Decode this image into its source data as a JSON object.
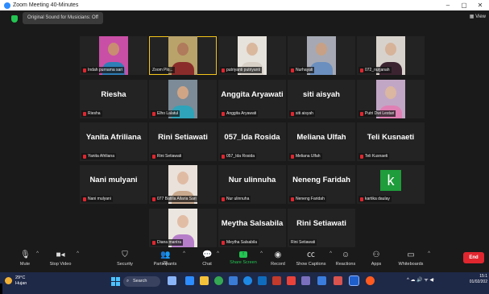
{
  "window": {
    "title": "Zoom Meeting 40-Minutes",
    "controls": [
      "–",
      "▢",
      "✕"
    ]
  },
  "infobar": {
    "sound_pill": "Original Sound for Musicians: Off",
    "view_label": "▦ View"
  },
  "tiles": [
    {
      "label": "Indah purnama sari",
      "video": true,
      "skin": "#c98d72",
      "cloth": "#2e7fb8",
      "bg": "#c94fa6",
      "active": false,
      "muted": true
    },
    {
      "label": "Zoom Plo...",
      "video": true,
      "skin": "#b07a5c",
      "cloth": "#8a2d2a",
      "bg": "#b9a36a",
      "active": true,
      "muted": false
    },
    {
      "label": "putriyanti putriyanti",
      "video": true,
      "skin": "#d9b89e",
      "cloth": "#d7d0c7",
      "bg": "#e6e2dc",
      "active": false,
      "muted": true
    },
    {
      "label": "Nurhayati",
      "video": true,
      "skin": "#c7a085",
      "cloth": "#6b8fbf",
      "bg": "#a6a9b3",
      "active": false,
      "muted": true
    },
    {
      "label": "072_nurjanah",
      "video": true,
      "skin": "#d6b399",
      "cloth": "#3b2430",
      "bg": "#d8d2cd",
      "active": false,
      "muted": true
    },
    {
      "label": "Riesha",
      "name": "Riesha",
      "video": false,
      "muted": true
    },
    {
      "label": "Elho Lalatul",
      "video": true,
      "skin": "#d0a586",
      "cloth": "#2fa3b9",
      "bg": "#7c8b97",
      "active": false,
      "muted": true
    },
    {
      "label": "Anggita Aryawati",
      "name": "Anggita Aryawati",
      "video": false,
      "muted": true
    },
    {
      "label": "siti aisyah",
      "name": "siti aisyah",
      "video": false,
      "muted": true
    },
    {
      "label": "Putri Dwi Lestari",
      "video": true,
      "skin": "#dbb6a0",
      "cloth": "#e07fb3",
      "bg": "#c2a6c5",
      "active": false,
      "muted": true
    },
    {
      "label": "Yanita Afriliana",
      "name": "Yanita Afriliana",
      "video": false,
      "muted": true
    },
    {
      "label": "Rini Setiawati",
      "name": "Rini Setiawati",
      "video": false,
      "muted": true
    },
    {
      "label": "057_Ida Rosida",
      "name": "057_Ida Rosida",
      "video": false,
      "muted": true
    },
    {
      "label": "Meliana Ulfah",
      "name": "Meliana Ulfah",
      "video": false,
      "muted": true
    },
    {
      "label": "Teli Kusnaeti",
      "name": "Teli Kusnaeti",
      "video": false,
      "muted": true
    },
    {
      "label": "Nani mulyani",
      "name": "Nani mulyani",
      "video": false,
      "muted": true
    },
    {
      "label": "077 Batilla Allaria Sari",
      "video": true,
      "skin": "#e0bba3",
      "cloth": "#c9a98d",
      "bg": "#e9e1da",
      "active": false,
      "muted": true
    },
    {
      "label": "Nur ulinnuha",
      "name": "Nur ulinnuha",
      "video": false,
      "muted": true
    },
    {
      "label": "Neneng Faridah",
      "name": "Neneng Faridah",
      "video": false,
      "muted": true
    },
    {
      "label": "kartika daulay",
      "avatar_letter": "k",
      "video": false,
      "muted": true
    },
    {
      "label": "Diana mantra",
      "video": true,
      "skin": "#e2bda5",
      "cloth": "#b67ec8",
      "bg": "#ece6e0",
      "active": false,
      "muted": true
    },
    {
      "label": "Meytha Salsabila",
      "name": "Meytha Salsabila",
      "video": false,
      "muted": true
    },
    {
      "label": "Rini Setiawati",
      "name": "Rini Setiawati",
      "video": false,
      "muted": false
    }
  ],
  "toolbar": {
    "mute": "Mute",
    "stop_video": "Stop Video",
    "security": "Security",
    "participants": "Participants",
    "participants_count": "23",
    "chat": "Chat",
    "share_screen": "Share Screen",
    "record": "Record",
    "show_captions": "Show Captions",
    "reactions": "Reactions",
    "apps": "Apps",
    "whiteboards": "Whiteboards",
    "end": "End"
  },
  "taskbar": {
    "weather_temp": "29°C",
    "weather_desc": "Hujan",
    "search": "Search",
    "tray": "^  ☁  🔊  ᯤ  ◀ᐧ",
    "time": "15:1",
    "date": "01/02/202"
  },
  "colors": {
    "accent_green": "#23c552",
    "end_red": "#e0262f",
    "active_border": "#f5c518",
    "avatar_green": "#1f9c3b"
  }
}
